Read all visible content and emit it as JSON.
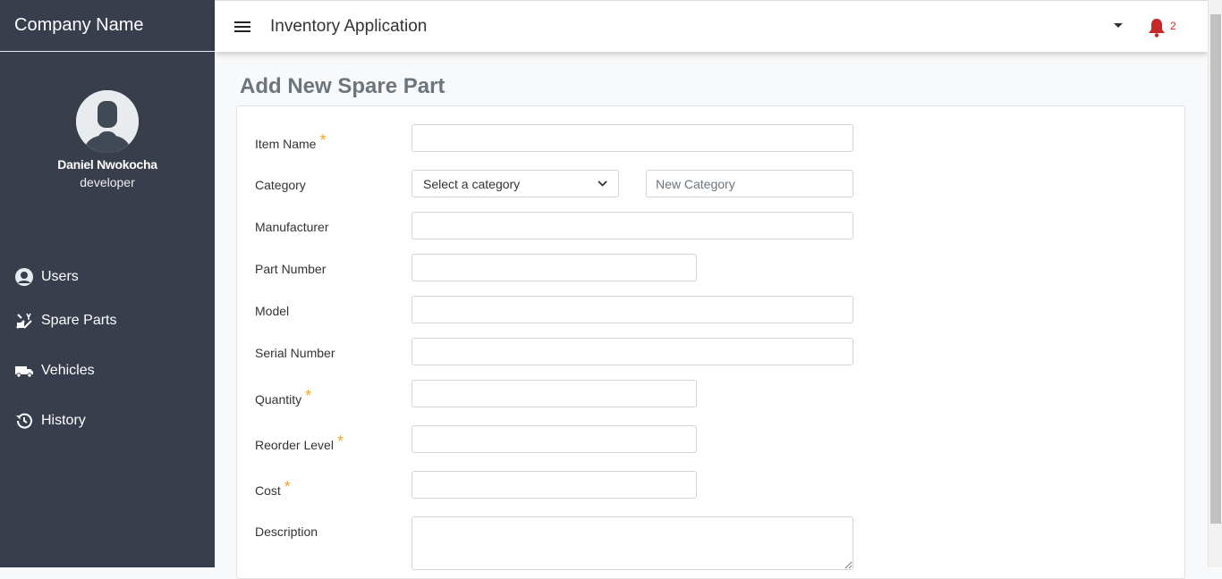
{
  "brand": "Company Name",
  "user": {
    "name": "Daniel Nwokocha",
    "role": "developer"
  },
  "nav": [
    {
      "label": "Users",
      "icon": "user-circle-icon"
    },
    {
      "label": "Spare Parts",
      "icon": "tools-icon"
    },
    {
      "label": "Vehicles",
      "icon": "truck-icon"
    },
    {
      "label": "History",
      "icon": "history-icon"
    }
  ],
  "header": {
    "title": "Inventory Application",
    "notification_count": "2"
  },
  "form": {
    "title": "Add New Spare Part",
    "fields": {
      "item_name": {
        "label": "Item Name",
        "required": true,
        "value": ""
      },
      "category": {
        "label": "Category",
        "select_value": "Select a category",
        "new_placeholder": "New Category"
      },
      "manufacturer": {
        "label": "Manufacturer",
        "value": ""
      },
      "part_number": {
        "label": "Part Number",
        "value": ""
      },
      "model": {
        "label": "Model",
        "value": ""
      },
      "serial_number": {
        "label": "Serial Number",
        "value": ""
      },
      "quantity": {
        "label": "Quantity",
        "required": true,
        "value": ""
      },
      "reorder_level": {
        "label": "Reorder Level",
        "required": true,
        "value": ""
      },
      "cost": {
        "label": "Cost",
        "required": true,
        "value": ""
      },
      "description": {
        "label": "Description",
        "value": ""
      }
    }
  },
  "colors": {
    "sidebar": "#393e4d",
    "required": "#f5a623",
    "bell": "#c62828",
    "title": "#6c757d"
  }
}
